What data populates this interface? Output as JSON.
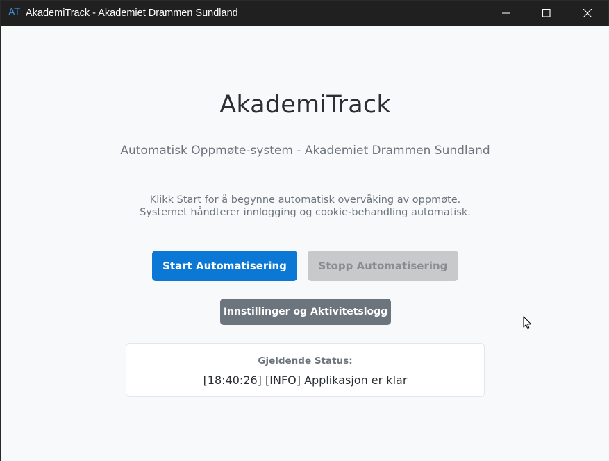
{
  "window": {
    "icon_text": "AT",
    "title": "AkademiTrack - Akademiet Drammen Sundland",
    "controls": [
      "minimize-icon",
      "maximize-icon",
      "close-icon"
    ]
  },
  "main": {
    "title": "AkademiTrack",
    "subtitle": "Automatisk Oppmøte-system - Akademiet Drammen Sundland",
    "instruction_line1": "Klikk Start for å begynne automatisk overvåking av oppmøte.",
    "instruction_line2": "Systemet håndterer innlogging og cookie-behandling automatisk."
  },
  "buttons": {
    "start_label": "Start Automatisering",
    "stop_label": "Stopp Automatisering",
    "settings_label": "Innstillinger og Aktivitetslogg"
  },
  "status": {
    "label": "Gjeldende Status:",
    "text": "[18:40:26] [INFO] Applikasjon er klar"
  },
  "colors": {
    "titlebar": "#202020",
    "primary": "#0a78d4",
    "disabled": "#c8c9ca",
    "secondary": "#6c757d",
    "background": "#f8f9fa"
  }
}
